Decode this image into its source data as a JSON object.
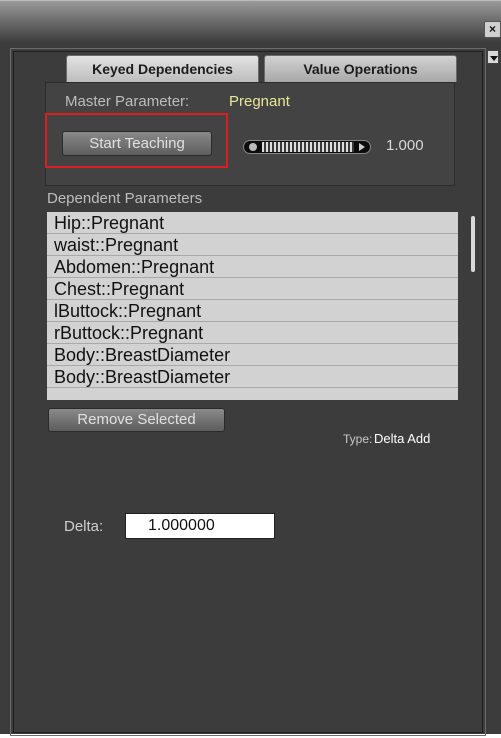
{
  "window": {
    "close_glyph": "×"
  },
  "tabs": [
    {
      "label": "Keyed Dependencies",
      "active": true
    },
    {
      "label": "Value Operations",
      "active": false
    }
  ],
  "master": {
    "label": "Master Parameter:",
    "value": "Pregnant"
  },
  "teaching": {
    "start_label": "Start Teaching",
    "dial_value": "1.000"
  },
  "dependents": {
    "header": "Dependent Parameters",
    "items": [
      "Hip::Pregnant",
      "waist::Pregnant",
      "Abdomen::Pregnant",
      "Chest::Pregnant",
      "lButtock::Pregnant",
      "rButtock::Pregnant",
      "Body::BreastDiameter",
      "Body::BreastDiameter"
    ],
    "remove_label": "Remove Selected"
  },
  "type": {
    "label": "Type:",
    "value": "Delta Add"
  },
  "delta": {
    "label": "Delta:",
    "value": "1.000000"
  },
  "colors": {
    "highlight": "#d91f1f",
    "panel": "#3c3c3c",
    "master_value": "#e7e79a"
  },
  "icons": {
    "close": "close-icon",
    "scroll": "chevron-down-icon"
  }
}
